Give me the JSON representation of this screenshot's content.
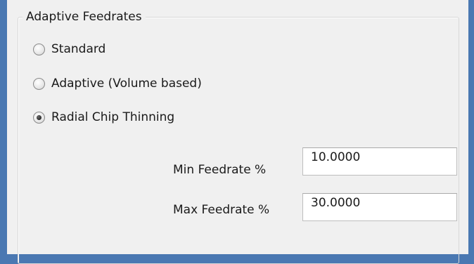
{
  "group": {
    "title": "Adaptive Feedrates"
  },
  "feedrate_mode": {
    "options": [
      {
        "label": "Standard",
        "selected": false
      },
      {
        "label": "Adaptive (Volume based)",
        "selected": false
      },
      {
        "label": "Radial Chip Thinning",
        "selected": true
      }
    ]
  },
  "fields": {
    "min_feedrate": {
      "label": "Min Feedrate %",
      "value": "10.0000"
    },
    "max_feedrate": {
      "label": "Max Feedrate %",
      "value": "30.0000"
    }
  },
  "colors": {
    "window_border": "#4a78b2",
    "dialog_background": "#f0f0f0",
    "input_background": "#ffffff"
  }
}
